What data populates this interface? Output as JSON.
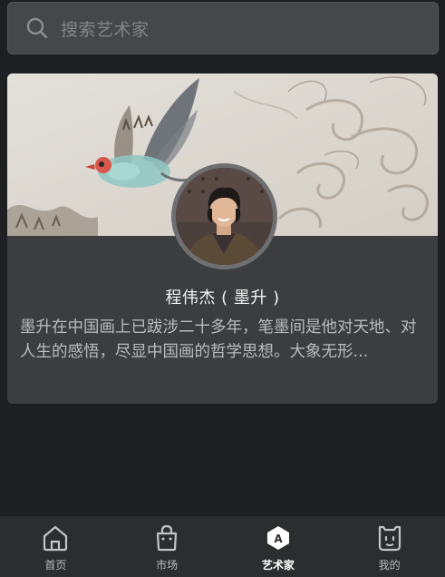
{
  "search": {
    "placeholder": "搜索艺术家",
    "icon": "search-icon"
  },
  "artist_card": {
    "name": "程伟杰 ( 墨升 )",
    "bio": "墨升在中国画上已跋涉二十多年，笔墨间是他对天地、对人生的感悟，尽显中国画的哲学思想。大象无形",
    "bio_ellipsis": "...",
    "banner": "chinese-painting-banner",
    "avatar": "artist-avatar"
  },
  "tabbar": {
    "items": [
      {
        "label": "首页",
        "icon": "home-icon",
        "active": false
      },
      {
        "label": "市场",
        "icon": "shopping-bag-icon",
        "active": false
      },
      {
        "label": "艺术家",
        "icon": "artist-hexagon-icon",
        "active": true,
        "badge": "A"
      },
      {
        "label": "我的",
        "icon": "profile-icon",
        "active": false
      }
    ]
  },
  "colors": {
    "background": "#1d1f20",
    "card": "#3b3d3e",
    "search": "#454849",
    "tabbar": "#2b2d2e",
    "text_primary": "#f4f4f4",
    "text_secondary": "#b9bcbe"
  }
}
